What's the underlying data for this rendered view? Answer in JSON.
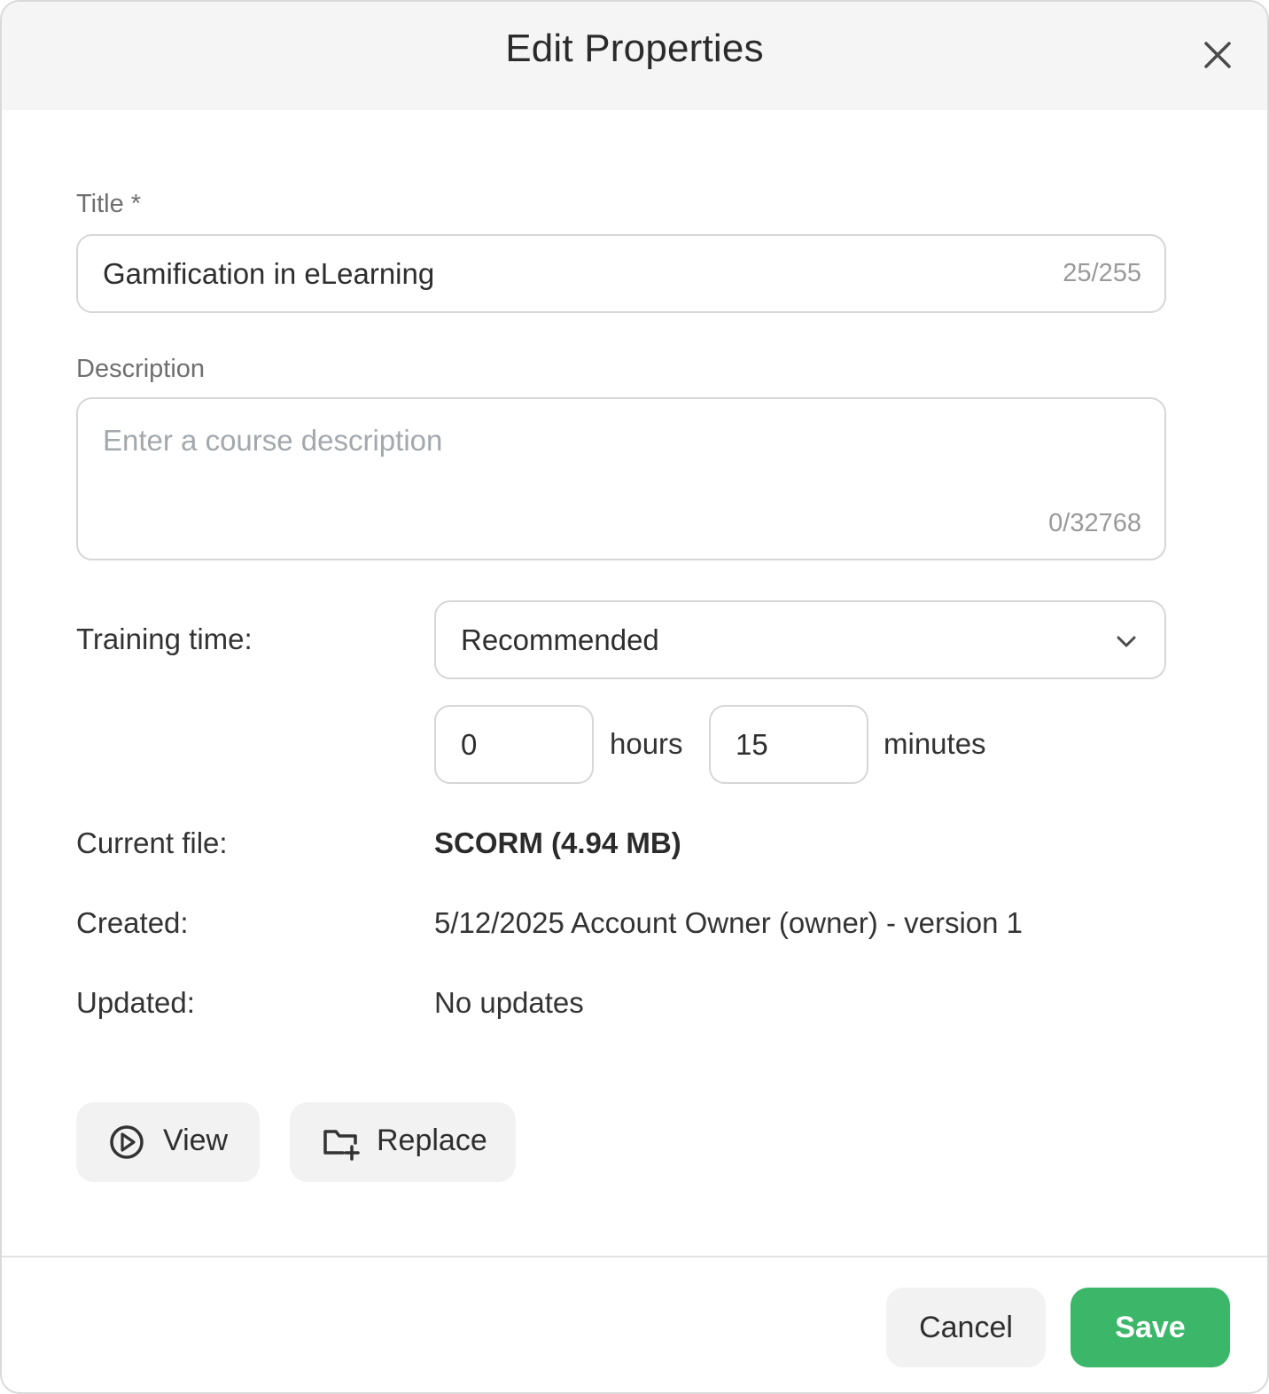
{
  "dialog": {
    "title": "Edit Properties"
  },
  "title_field": {
    "label": "Title *",
    "value": "Gamification in eLearning",
    "counter": "25/255"
  },
  "description_field": {
    "label": "Description",
    "placeholder": "Enter a course description",
    "counter": "0/32768"
  },
  "training_time": {
    "label": "Training time:",
    "selected": "Recommended",
    "hours_value": "0",
    "hours_unit": "hours",
    "minutes_value": "15",
    "minutes_unit": "minutes"
  },
  "info": {
    "current_file_label": "Current file:",
    "current_file_value": "SCORM (4.94 MB)",
    "created_label": "Created:",
    "created_value": "5/12/2025 Account Owner (owner) - version 1",
    "updated_label": "Updated:",
    "updated_value": "No updates"
  },
  "actions": {
    "view_label": "View",
    "replace_label": "Replace"
  },
  "footer": {
    "cancel_label": "Cancel",
    "save_label": "Save"
  },
  "colors": {
    "accent": "#3cb76a",
    "header_bg": "#f5f5f5",
    "button_bg": "#f2f2f2"
  },
  "icons": {
    "close": "close-icon",
    "dropdown": "chevron-down-icon",
    "view": "play-circle-icon",
    "replace": "folder-plus-icon"
  }
}
